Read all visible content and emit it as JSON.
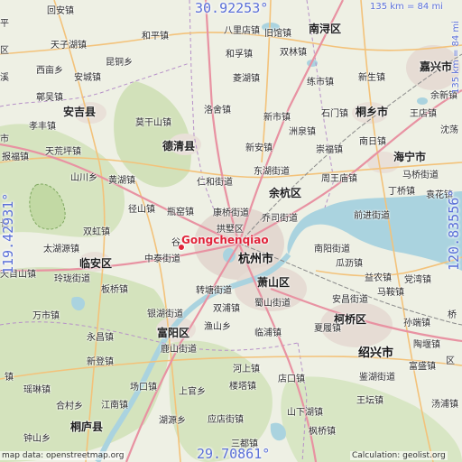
{
  "map": {
    "coords": {
      "top_lat": "30.92253°",
      "bottom_lat": "29.70861°",
      "left_lon": "119.42931°",
      "right_lon": "120.83556°"
    },
    "scale": {
      "horizontal": "135 km = 84 mi",
      "vertical": "135 km = 84 mi"
    },
    "marker": {
      "label": "Gongchenqiao"
    },
    "attribution": {
      "left": "map data: openstreetmap.org",
      "right": "Calculation: geolist.org"
    },
    "colors": {
      "marker": "#e0243a",
      "coords": "#5a6fd8",
      "water": "#aad3df",
      "road_primary": "#e892a2",
      "road_secondary": "#f9d69b",
      "urban": "#e3d8d0",
      "forest": "#c8dbaa"
    },
    "labels": [
      {
        "id": "l01",
        "text": "回安镇",
        "cls": ""
      },
      {
        "id": "l02",
        "text": "八里店镇",
        "cls": ""
      },
      {
        "id": "l03",
        "text": "南浔区",
        "cls": ""
      },
      {
        "id": "l04",
        "text": "旧馆镇",
        "cls": ""
      },
      {
        "id": "l05",
        "text": "和平镇",
        "cls": ""
      },
      {
        "id": "l06",
        "text": "和孚镇",
        "cls": ""
      },
      {
        "id": "l07",
        "text": "双林镇",
        "cls": ""
      },
      {
        "id": "l08",
        "text": "嘉兴市",
        "cls": "big"
      },
      {
        "id": "l09",
        "text": "天子湖镇",
        "cls": ""
      },
      {
        "id": "l10",
        "text": "昆铜乡",
        "cls": ""
      },
      {
        "id": "l11",
        "text": "菱湖镇",
        "cls": ""
      },
      {
        "id": "l12",
        "text": "练市镇",
        "cls": ""
      },
      {
        "id": "l13",
        "text": "新生镇",
        "cls": ""
      },
      {
        "id": "l14",
        "text": "西亩乡",
        "cls": ""
      },
      {
        "id": "l15",
        "text": "安城镇",
        "cls": ""
      },
      {
        "id": "l16",
        "text": "余新镇",
        "cls": ""
      },
      {
        "id": "l17",
        "text": "溪",
        "cls": ""
      },
      {
        "id": "l18",
        "text": "鄣吴镇",
        "cls": ""
      },
      {
        "id": "l19",
        "text": "安吉县",
        "cls": "big"
      },
      {
        "id": "l20",
        "text": "洛舍镇",
        "cls": ""
      },
      {
        "id": "l21",
        "text": "新市镇",
        "cls": ""
      },
      {
        "id": "l22",
        "text": "石门镇",
        "cls": ""
      },
      {
        "id": "l23",
        "text": "桐乡市",
        "cls": "big"
      },
      {
        "id": "l24",
        "text": "王店镇",
        "cls": ""
      },
      {
        "id": "l25",
        "text": "孝丰镇",
        "cls": ""
      },
      {
        "id": "l26",
        "text": "莫干山镇",
        "cls": ""
      },
      {
        "id": "l27",
        "text": "洲泉镇",
        "cls": ""
      },
      {
        "id": "l28",
        "text": "沈荡",
        "cls": ""
      },
      {
        "id": "l29",
        "text": "天荒坪镇",
        "cls": ""
      },
      {
        "id": "l30",
        "text": "德清县",
        "cls": "big"
      },
      {
        "id": "l31",
        "text": "新安镇",
        "cls": ""
      },
      {
        "id": "l32",
        "text": "崇福镇",
        "cls": ""
      },
      {
        "id": "l33",
        "text": "南日镇",
        "cls": ""
      },
      {
        "id": "l34",
        "text": "海宁市",
        "cls": "big"
      },
      {
        "id": "l35",
        "text": "报福镇",
        "cls": ""
      },
      {
        "id": "l36",
        "text": "东湖街道",
        "cls": ""
      },
      {
        "id": "l37",
        "text": "马桥街道",
        "cls": ""
      },
      {
        "id": "l38",
        "text": "山川乡",
        "cls": ""
      },
      {
        "id": "l39",
        "text": "黄湖镇",
        "cls": ""
      },
      {
        "id": "l40",
        "text": "仁和街道",
        "cls": ""
      },
      {
        "id": "l41",
        "text": "余杭区",
        "cls": "big"
      },
      {
        "id": "l42",
        "text": "周王庙镇",
        "cls": ""
      },
      {
        "id": "l43",
        "text": "丁桥镇",
        "cls": ""
      },
      {
        "id": "l44",
        "text": "袁花镇",
        "cls": ""
      },
      {
        "id": "l45",
        "text": "径山镇",
        "cls": ""
      },
      {
        "id": "l46",
        "text": "瓶窑镇",
        "cls": ""
      },
      {
        "id": "l47",
        "text": "康桥街道",
        "cls": ""
      },
      {
        "id": "l48",
        "text": "乔司街道",
        "cls": ""
      },
      {
        "id": "l49",
        "text": "前进街道",
        "cls": ""
      },
      {
        "id": "l50",
        "text": "双虹镇",
        "cls": ""
      },
      {
        "id": "l51",
        "text": "拱墅区",
        "cls": ""
      },
      {
        "id": "l52",
        "text": "太湖源镇",
        "cls": ""
      },
      {
        "id": "l53",
        "text": "杭州市",
        "cls": "city"
      },
      {
        "id": "l54",
        "text": "南阳街道",
        "cls": ""
      },
      {
        "id": "l55",
        "text": "临安区",
        "cls": "big"
      },
      {
        "id": "l56",
        "text": "中泰街道",
        "cls": ""
      },
      {
        "id": "l57",
        "text": "瓜沥镇",
        "cls": ""
      },
      {
        "id": "l58",
        "text": "天目山镇",
        "cls": ""
      },
      {
        "id": "l59",
        "text": "玲珑街道",
        "cls": ""
      },
      {
        "id": "l60",
        "text": "益农镇",
        "cls": ""
      },
      {
        "id": "l61",
        "text": "板桥镇",
        "cls": ""
      },
      {
        "id": "l62",
        "text": "转塘街道",
        "cls": ""
      },
      {
        "id": "l63",
        "text": "萧山区",
        "cls": "big"
      },
      {
        "id": "l64",
        "text": "党湾镇",
        "cls": ""
      },
      {
        "id": "l65",
        "text": "安昌街道",
        "cls": ""
      },
      {
        "id": "l66",
        "text": "马鞍镇",
        "cls": ""
      },
      {
        "id": "l67",
        "text": "蜀山街道",
        "cls": ""
      },
      {
        "id": "l68",
        "text": "银湖街道",
        "cls": ""
      },
      {
        "id": "l69",
        "text": "万市镇",
        "cls": ""
      },
      {
        "id": "l70",
        "text": "双浦镇",
        "cls": ""
      },
      {
        "id": "l71",
        "text": "柯桥区",
        "cls": "big"
      },
      {
        "id": "l72",
        "text": "孙端镇",
        "cls": ""
      },
      {
        "id": "l73",
        "text": "富阳区",
        "cls": "big"
      },
      {
        "id": "l74",
        "text": "渔山乡",
        "cls": ""
      },
      {
        "id": "l75",
        "text": "临浦镇",
        "cls": ""
      },
      {
        "id": "l76",
        "text": "永昌镇",
        "cls": ""
      },
      {
        "id": "l77",
        "text": "夏履镇",
        "cls": ""
      },
      {
        "id": "l78",
        "text": "陶堰镇",
        "cls": ""
      },
      {
        "id": "l79",
        "text": "鹿山街道",
        "cls": ""
      },
      {
        "id": "l80",
        "text": "绍兴市",
        "cls": "city"
      },
      {
        "id": "l81",
        "text": "新登镇",
        "cls": ""
      },
      {
        "id": "l82",
        "text": "河上镇",
        "cls": ""
      },
      {
        "id": "l83",
        "text": "富盛镇",
        "cls": ""
      },
      {
        "id": "l84",
        "text": "瑶琳镇",
        "cls": ""
      },
      {
        "id": "l85",
        "text": "鉴湖街道",
        "cls": ""
      },
      {
        "id": "l86",
        "text": "场口镇",
        "cls": ""
      },
      {
        "id": "l87",
        "text": "楼塔镇",
        "cls": ""
      },
      {
        "id": "l88",
        "text": "汤浦镇",
        "cls": ""
      },
      {
        "id": "l89",
        "text": "合村乡",
        "cls": ""
      },
      {
        "id": "l90",
        "text": "上官乡",
        "cls": ""
      },
      {
        "id": "l91",
        "text": "店口镇",
        "cls": ""
      },
      {
        "id": "l92",
        "text": "江南镇",
        "cls": ""
      },
      {
        "id": "l93",
        "text": "山下湖镇",
        "cls": ""
      },
      {
        "id": "l94",
        "text": "王坛镇",
        "cls": ""
      },
      {
        "id": "l95",
        "text": "桐庐县",
        "cls": "big"
      },
      {
        "id": "l96",
        "text": "湖源乡",
        "cls": ""
      },
      {
        "id": "l97",
        "text": "应店街镇",
        "cls": ""
      },
      {
        "id": "l98",
        "text": "枫桥镇",
        "cls": ""
      },
      {
        "id": "l99",
        "text": "钟山乡",
        "cls": ""
      },
      {
        "id": "l100",
        "text": "三都镇",
        "cls": ""
      },
      {
        "id": "l101",
        "text": "平",
        "cls": ""
      },
      {
        "id": "l102",
        "text": "桥",
        "cls": ""
      },
      {
        "id": "l103",
        "text": "区",
        "cls": ""
      },
      {
        "id": "l104",
        "text": "区",
        "cls": ""
      },
      {
        "id": "l105",
        "text": "谷",
        "cls": ""
      },
      {
        "id": "l106",
        "text": "长",
        "cls": ""
      },
      {
        "id": "l107",
        "text": "市",
        "cls": ""
      },
      {
        "id": "l108",
        "text": "镇",
        "cls": ""
      }
    ]
  }
}
